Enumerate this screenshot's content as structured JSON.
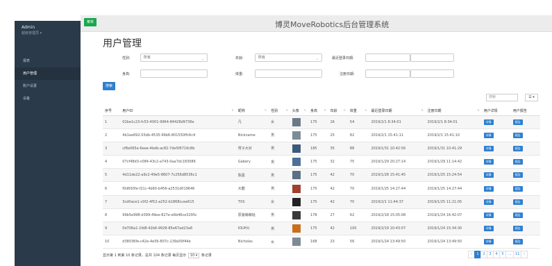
{
  "sidebar": {
    "user_name": "Admin",
    "user_role": "超级管理员 ▾",
    "items": [
      {
        "label": "报表",
        "active": false
      },
      {
        "label": "用户管理",
        "active": true
      },
      {
        "label": "账户设置",
        "active": false
      },
      {
        "label": "设备",
        "active": false
      }
    ]
  },
  "header": {
    "toggle_label": "菜单",
    "title": "博灵MoveRobotics后台管理系统"
  },
  "page": {
    "title": "用户管理"
  },
  "filters": {
    "gender_label": "性别:",
    "gender_value": "所有",
    "age_label": "年龄:",
    "age_value": "所有",
    "last_login_label": "最近登录日期:",
    "last_login_value": "",
    "height_label": "身高:",
    "height_value": "",
    "weight_label": "体重:",
    "weight_value": "",
    "register_label": "注册日期:",
    "register_value": "",
    "search_button": "搜索"
  },
  "table_tools": {
    "search_placeholder": "搜索",
    "columns_button": "☰ ▾"
  },
  "table": {
    "columns": [
      "序号",
      "用户ID",
      "昵称",
      "性别",
      "头像",
      "身高",
      "年龄",
      "体重",
      "最近登录日期",
      "注册日期",
      "用户详情",
      "用户报告"
    ],
    "detail_btn": "详情",
    "report_btn": "报告",
    "rows": [
      {
        "idx": "1",
        "id": "02be1c23-fc53-4001-9964-84428d9736e",
        "nick": "凡",
        "gender": "女",
        "height": "175",
        "age": "16",
        "weight": "54",
        "last": "2019/2/1 8:34:01",
        "reg": "2019/2/1 8:34:01",
        "avatar_color": "#6b7a86"
      },
      {
        "idx": "2",
        "id": "4b1ee692-03db-4535-99b6-801550ffc6c4",
        "nick": "Nickname",
        "gender": "男",
        "height": "175",
        "age": "25",
        "weight": "82",
        "last": "2019/2/1 15:41:11",
        "reg": "2019/2/1 15:41:10",
        "avatar_color": "#7d8b94"
      },
      {
        "idx": "3",
        "id": "cf8e065e-6eee-4bdb-ac82-7de5f6716c8b",
        "nick": "胃子大对",
        "gender": "男",
        "height": "185",
        "age": "35",
        "weight": "88",
        "last": "2019/1/31 10:42:56",
        "reg": "2019/1/31 10:41:29",
        "avatar_color": "#3e5a7a"
      },
      {
        "idx": "4",
        "id": "07cf48d3-c084-43c2-a743-0aa7dc183086",
        "nick": "Gabery",
        "gender": "男",
        "height": "175",
        "age": "32",
        "weight": "75",
        "last": "2019/1/29 20:27:14",
        "reg": "2019/1/29 11:14:42",
        "avatar_color": "#4c6f9a"
      },
      {
        "idx": "5",
        "id": "4d11de22-a9c2-49e5-8607-7c256d8536c1",
        "nick": "陈嘉",
        "gender": "男",
        "height": "175",
        "age": "42",
        "weight": "70",
        "last": "2019/1/28 15:41:45",
        "reg": "2019/1/25 15:24:54",
        "avatar_color": "#5a6f86"
      },
      {
        "idx": "6",
        "id": "f0d693fe-f21c-4b60-b456-a2531d019646",
        "nick": "大酷",
        "gender": "男",
        "height": "175",
        "age": "42",
        "weight": "70",
        "last": "2019/1/25 14:27:44",
        "reg": "2019/1/25 14:27:44",
        "avatar_color": "#a0402e"
      },
      {
        "idx": "7",
        "id": "3cd0ace1-c0f2-4f52-a252-b1868ccee615",
        "nick": "TXS",
        "gender": "女",
        "height": "175",
        "age": "42",
        "weight": "70",
        "last": "2019/2/1 11:44:37",
        "reg": "2019/1/25 11:21:05",
        "avatar_color": "#222222"
      },
      {
        "idx": "8",
        "id": "99b5e998-d399-49ee-827e-e6b46ce3295c",
        "nick": "原装萌萌哒",
        "gender": "男",
        "height": "178",
        "age": "27",
        "weight": "62",
        "last": "2019/2/18 15:05:08",
        "reg": "2019/1/24 16:42:07",
        "avatar_color": "#3a3a3a"
      },
      {
        "idx": "9",
        "id": "0d706a1-1fd8-42b6-9928-85e67ad23a8",
        "nick": "IOUHU",
        "gender": "男",
        "height": "175",
        "age": "42",
        "weight": "100",
        "last": "2019/2/19 10:43:07",
        "reg": "2019/1/24 15:34:30",
        "avatar_color": "#c8701e"
      },
      {
        "idx": "10",
        "id": "d38036fe-c42e-4e56-807c-139a59f44e",
        "nick": "Nicholas",
        "gender": "女",
        "height": "168",
        "age": "23",
        "weight": "56",
        "last": "2019/1/24 13:49:50",
        "reg": "2019/1/24 13:49:50",
        "avatar_color": "#7d8b94"
      }
    ]
  },
  "footer": {
    "summary_prefix": "显示第 1 到第 10 条记录，总共 104 条记录 每页显示",
    "page_size": "10 ▾",
    "summary_suffix": "条记录",
    "pages": [
      "‹",
      "1",
      "2",
      "3",
      "4",
      "5",
      "...",
      "11",
      "›"
    ],
    "active_page": "1"
  },
  "colors": {
    "sidebar_bg": "#2b3a4a",
    "accent_blue": "#2e7fd0",
    "accent_green": "#1aa74f"
  }
}
